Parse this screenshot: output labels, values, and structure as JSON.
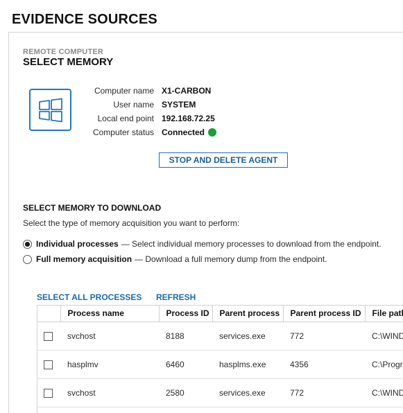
{
  "page": {
    "title": "EVIDENCE SOURCES"
  },
  "header": {
    "subtitle": "REMOTE COMPUTER",
    "heading": "SELECT MEMORY"
  },
  "computer": {
    "icon": "windows-logo-icon",
    "rows": [
      {
        "label": "Computer name",
        "value": "X1-CARBON"
      },
      {
        "label": "User name",
        "value": "SYSTEM"
      },
      {
        "label": "Local end point",
        "value": "192.168.72.25"
      },
      {
        "label": "Computer status",
        "value": "Connected"
      }
    ],
    "status_color": "#19a035"
  },
  "agent_button": {
    "label": "STOP AND DELETE AGENT"
  },
  "memory": {
    "title": "SELECT MEMORY TO DOWNLOAD",
    "description": "Select the type of memory acquisition you want to perform:",
    "options": [
      {
        "label": "Individual processes",
        "description": "— Select individual memory processes to download from the endpoint.",
        "selected": true
      },
      {
        "label": "Full memory acquisition",
        "description": "— Download a full memory dump from the endpoint.",
        "selected": false
      }
    ]
  },
  "actions": {
    "select_all": "SELECT ALL PROCESSES",
    "refresh": "REFRESH"
  },
  "table": {
    "columns": [
      "",
      "Process name",
      "Process ID",
      "Parent process",
      "Parent process ID",
      "File path"
    ],
    "rows": [
      {
        "name": "svchost",
        "pid": "8188",
        "parent": "services.exe",
        "ppid": "772",
        "path": "C:\\WINDOWS"
      },
      {
        "name": "hasplmv",
        "pid": "6460",
        "parent": "hasplms.exe",
        "ppid": "4356",
        "path": "C:\\Program"
      },
      {
        "name": "svchost",
        "pid": "2580",
        "parent": "services.exe",
        "ppid": "772",
        "path": "C:\\WINDOWS"
      }
    ]
  },
  "accent_color": "#1f7ab8"
}
